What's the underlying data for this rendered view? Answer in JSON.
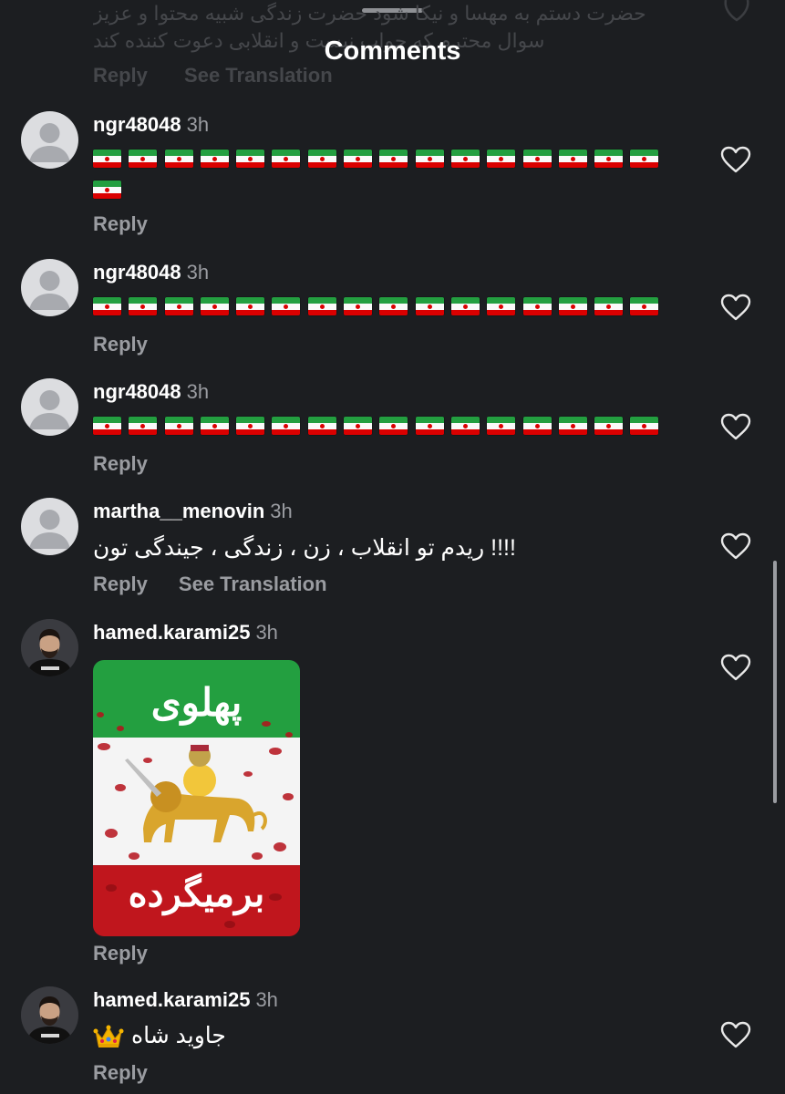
{
  "header": {
    "title": "Comments"
  },
  "previous_comment": {
    "line1": "حضرت دستم به مهسا و نیکا شود حضرت زندگی شبیه محتوا و عزیز",
    "line2": "سوال محترم که جواب نیست و انقلابی دعوت کننده کند",
    "reply_label": "Reply",
    "see_translation_label": "See Translation"
  },
  "comments": [
    {
      "username": "ngr48048",
      "time": "3h",
      "reply_label": "Reply",
      "flags_line1": 16,
      "flags_line2": 1
    },
    {
      "username": "ngr48048",
      "time": "3h",
      "reply_label": "Reply",
      "flags_line1": 16
    },
    {
      "username": "ngr48048",
      "time": "3h",
      "reply_label": "Reply",
      "flags_line1": 16
    },
    {
      "username": "martha__menovin",
      "time": "3h",
      "text": "!!!! ریدم تو انقلاب ، زن ، زندگی ، جیندگی تون",
      "reply_label": "Reply",
      "see_translation_label": "See Translation"
    },
    {
      "username": "hamed.karami25",
      "time": "3h",
      "reply_label": "Reply",
      "image": {
        "top_text": "پهلوی",
        "bottom_text": "برمیگرده"
      }
    },
    {
      "username": "hamed.karami25",
      "time": "3h",
      "text": "جاوید شاه",
      "emoji": "crown",
      "reply_label": "Reply"
    }
  ],
  "icons": {
    "heart": "heart-outline-icon",
    "avatar_default": "default-avatar-icon",
    "crown": "crown-emoji-icon",
    "flag": "iran-flag-emoji"
  },
  "colors": {
    "background": "#1c1e21",
    "text_primary": "#ffffff",
    "text_secondary": "#9a9ca1",
    "flag_green": "#239f40",
    "flag_red": "#da0000"
  }
}
